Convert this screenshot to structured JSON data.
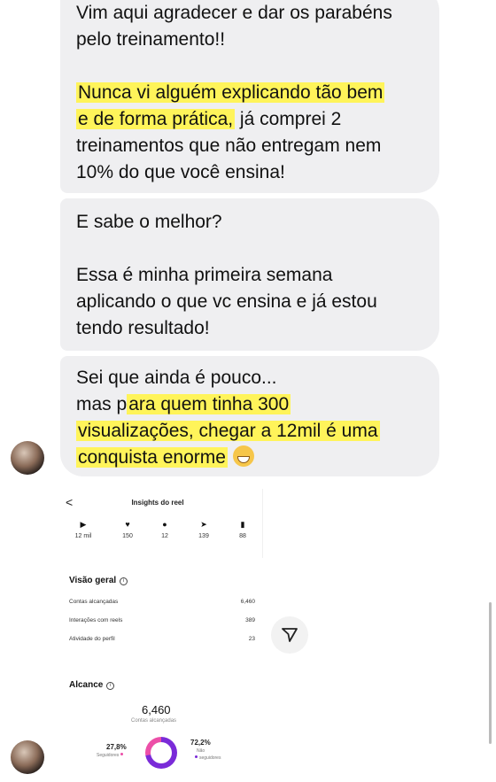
{
  "messages": {
    "m1_line1": "Vim aqui agradecer e dar os parabéns",
    "m1_line2": "pelo treinamento!!",
    "m1_hl1": "Nunca vi alguém explicando tão bem",
    "m1_hl2": "e de forma prática,",
    "m1_rest1": " já comprei 2",
    "m1_rest2": "treinamentos que não entregam nem",
    "m1_rest3": "10% do que você ensina!",
    "m2_line1": "E sabe o melhor?",
    "m2_line2": "Essa é minha primeira semana",
    "m2_line3": "aplicando o que vc ensina e já estou",
    "m2_line4": "tendo resultado!",
    "m3_line1": "Sei que ainda é pouco...",
    "m3_pre": "mas p",
    "m3_hl1": "ara quem tinha 300",
    "m3_hl2": "visualizações, chegar a 12mil é uma",
    "m3_hl3": "conquista enorme",
    "m3_emoji": "grinning-face-emoji"
  },
  "insights": {
    "back_icon": "chevron-left-icon",
    "back_glyph": "<",
    "title": "Insights do reel",
    "metrics": [
      {
        "icon": "play-icon",
        "glyph": "▶",
        "value": "12 mil"
      },
      {
        "icon": "heart-icon",
        "glyph": "♥",
        "value": "150"
      },
      {
        "icon": "comment-icon",
        "glyph": "●",
        "value": "12"
      },
      {
        "icon": "send-icon",
        "glyph": "➤",
        "value": "139"
      },
      {
        "icon": "bookmark-icon",
        "glyph": "▮",
        "value": "88"
      }
    ]
  },
  "overview": {
    "title": "Visão geral",
    "info_glyph": "i",
    "rows": [
      {
        "label": "Contas alcançadas",
        "value": "6,460"
      },
      {
        "label": "Interações com reels",
        "value": "389"
      },
      {
        "label": "Atividade do perfil",
        "value": "23"
      }
    ]
  },
  "reach": {
    "title": "Alcance",
    "info_glyph": "i",
    "total": "6,460",
    "total_label": "Contas alcançadas",
    "followers_pct": "27,8%",
    "followers_label": "Seguidores",
    "followers_color": "#ec4fa8",
    "nonfollowers_pct": "72,2%",
    "nonfollowers_label1": "Não",
    "nonfollowers_label2": "seguidores",
    "nonfollowers_color": "#7a2bd8",
    "nonfollowers_share": 0.722
  },
  "colors": {
    "highlight": "#fff45a",
    "bubble": "#efeff1"
  }
}
